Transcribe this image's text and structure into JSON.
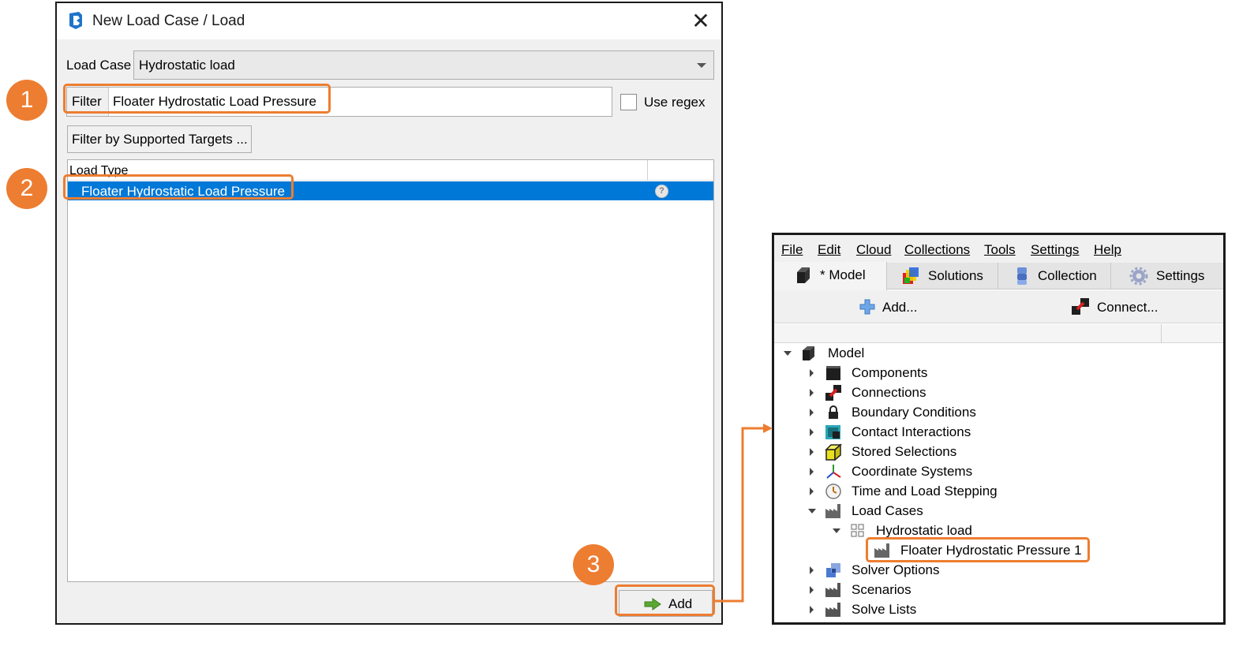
{
  "dialog": {
    "title": "New Load Case / Load",
    "close_glyph": "✕",
    "load_case_label": "Load Case",
    "load_case_value": "Hydrostatic load",
    "filter_label": "Filter",
    "filter_value": "Floater Hydrostatic Load Pressure",
    "use_regex_label": "Use regex",
    "use_regex_checked": false,
    "filter_targets_button": "Filter by Supported Targets ...",
    "list_header": "Load Type",
    "list_items": [
      {
        "label": "Floater Hydrostatic Load Pressure",
        "selected": true,
        "help_glyph": "?"
      }
    ],
    "add_button": "Add"
  },
  "callouts": [
    "1",
    "2",
    "3"
  ],
  "model_window": {
    "menu": [
      "File",
      "Edit",
      "Cloud",
      "Collections",
      "Tools",
      "Settings",
      "Help"
    ],
    "tabs": [
      {
        "label": "* Model",
        "icon": "model-cube-icon",
        "active": true
      },
      {
        "label": "Solutions",
        "icon": "solutions-icon",
        "active": false
      },
      {
        "label": "Collection",
        "icon": "collection-icon",
        "active": false
      },
      {
        "label": "Settings",
        "icon": "gear-icon",
        "active": false
      }
    ],
    "toolbar": {
      "add_label": "Add...",
      "connect_label": "Connect..."
    },
    "tree": [
      {
        "label": "Model",
        "expanded": true,
        "icon": "model-cube-icon"
      },
      {
        "label": "Components",
        "expanded": false,
        "icon": "components-icon"
      },
      {
        "label": "Connections",
        "expanded": false,
        "icon": "connections-icon"
      },
      {
        "label": "Boundary Conditions",
        "expanded": false,
        "icon": "lock-icon"
      },
      {
        "label": "Contact Interactions",
        "expanded": false,
        "icon": "contact-icon"
      },
      {
        "label": "Stored Selections",
        "expanded": false,
        "icon": "selection-icon"
      },
      {
        "label": "Coordinate Systems",
        "expanded": false,
        "icon": "axes-icon"
      },
      {
        "label": "Time and Load Stepping",
        "expanded": false,
        "icon": "clock-icon"
      },
      {
        "label": "Load Cases",
        "expanded": true,
        "icon": "factory-icon"
      },
      {
        "label": "Hydrostatic load",
        "expanded": true,
        "icon": "grid-icon"
      },
      {
        "label": "Floater Hydrostatic Pressure 1",
        "icon": "factory-icon"
      },
      {
        "label": "Solver Options",
        "expanded": false,
        "icon": "solver-icon"
      },
      {
        "label": "Scenarios",
        "expanded": false,
        "icon": "factory-icon"
      },
      {
        "label": "Solve Lists",
        "expanded": false,
        "icon": "factory-icon"
      }
    ]
  },
  "colors": {
    "accent_orange": "#ed7d31",
    "selection_blue": "#0078d7"
  }
}
